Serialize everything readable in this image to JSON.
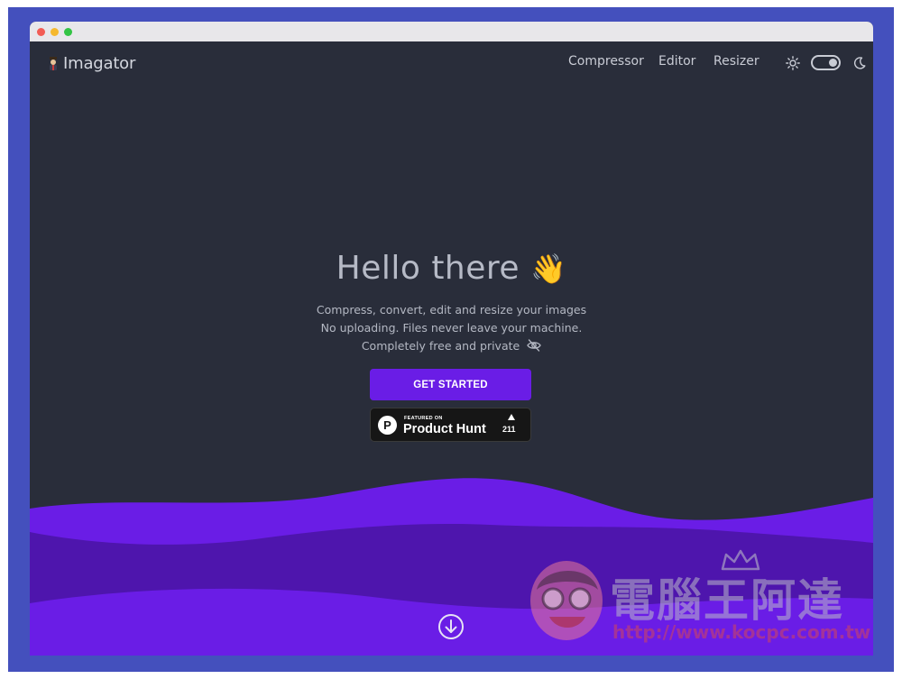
{
  "brand": {
    "name": "Imagator"
  },
  "nav": {
    "links": [
      {
        "label": "Compressor"
      },
      {
        "label": "Editor"
      },
      {
        "label": "Resizer"
      }
    ],
    "theme_toggle": {
      "mode": "dark",
      "left_icon": "sun-icon",
      "right_icon": "moon-icon"
    }
  },
  "hero": {
    "title": "Hello there",
    "title_emoji": "👋",
    "lines": [
      "Compress, convert, edit and resize your images",
      "No uploading. Files never leave your machine.",
      "Completely free and private"
    ],
    "privacy_icon": "eye-off-icon",
    "cta_label": "GET STARTED"
  },
  "product_hunt": {
    "featured_label": "FEATURED ON",
    "name": "Product Hunt",
    "logo_letter": "P",
    "upvotes": "211"
  },
  "scroll_icon": "arrow-down-circle-icon",
  "watermark": {
    "title": "電腦王阿達",
    "url": "http://www.kocpc.com.tw"
  },
  "colors": {
    "background": "#292d3a",
    "accent": "#6a1de6",
    "wave_light": "#6a1de6",
    "wave_dark": "#4e15ad",
    "text_muted": "#b4b8c3",
    "frame": "#4450bd"
  }
}
